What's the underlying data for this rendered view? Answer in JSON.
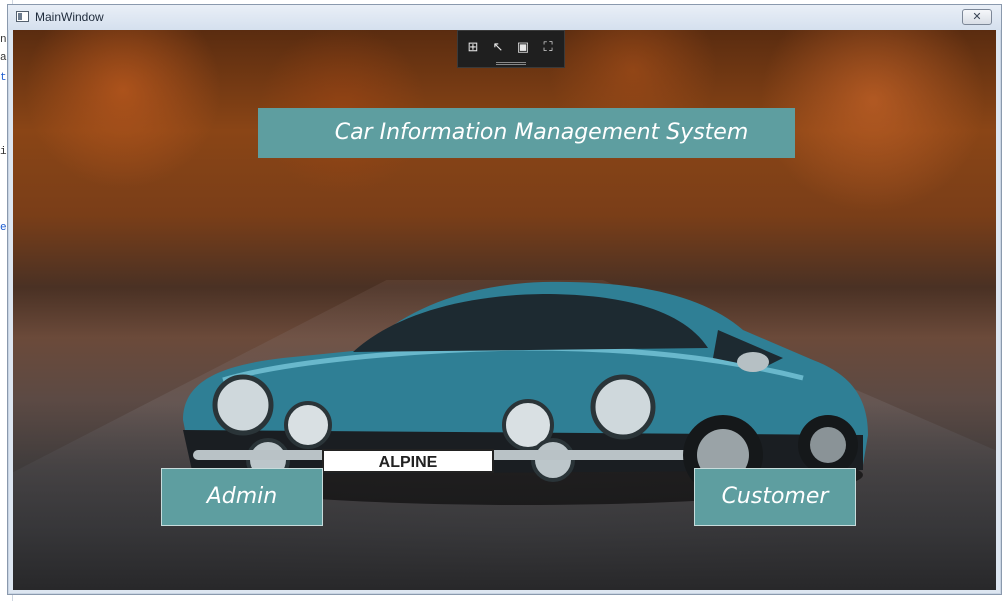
{
  "window": {
    "title": "MainWindow",
    "close_label": "✕"
  },
  "debug_toolbar": {
    "icons": [
      "live-visual-tree-icon",
      "select-element-icon",
      "display-layout-adorners-icon",
      "track-focused-element-icon"
    ]
  },
  "main": {
    "heading": "Car Information Management System",
    "background": "blue Alpine classic car on autumn road",
    "car_plate": "ALPINE"
  },
  "buttons": {
    "admin_label": "Admin",
    "customer_label": "Customer"
  },
  "colors": {
    "accent": "#5e9ea0",
    "text": "#ffffff",
    "toolbar_bg": "#1f1f1f"
  }
}
